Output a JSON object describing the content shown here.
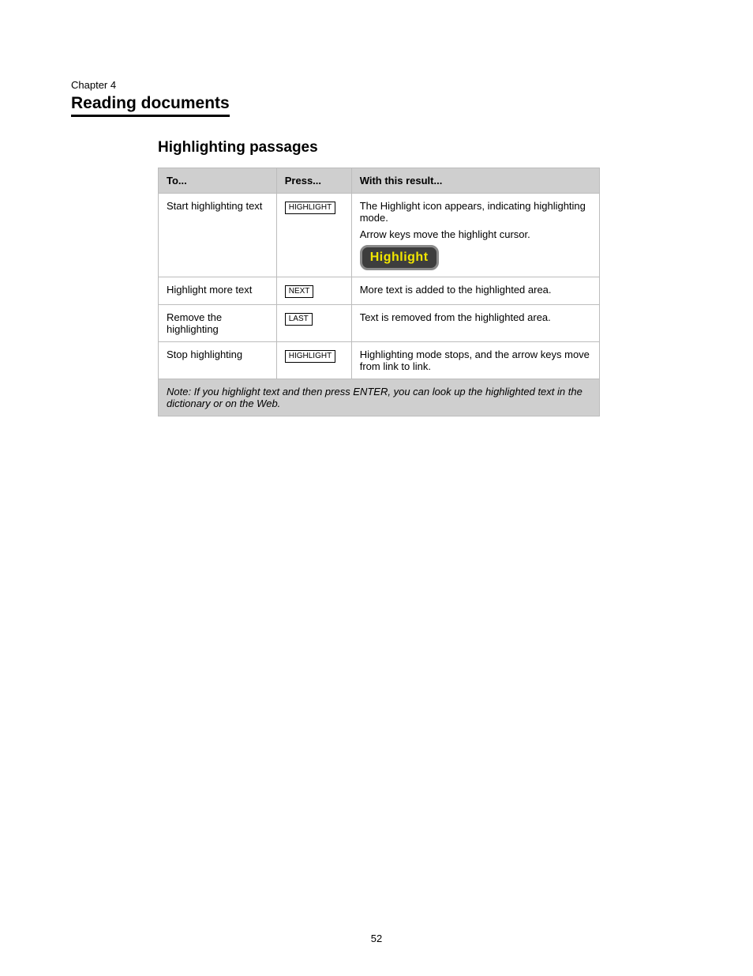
{
  "chapter_line": "Chapter 4",
  "section_title": "Reading documents",
  "section_subhead": "Highlighting passages",
  "table": {
    "headers": {
      "to": "To...",
      "press": "Press...",
      "result": "With this result..."
    },
    "rows": [
      {
        "to": "Start highlighting text",
        "key": "HIGHLIGHT",
        "result_lines": [
          "The Highlight icon appears, indicating highlighting mode.",
          "Arrow keys move the highlight cursor."
        ],
        "show_button": true
      },
      {
        "to": "Highlight more text",
        "key": "NEXT",
        "result_lines": [
          "More text is added to the highlighted area."
        ]
      },
      {
        "to": "Remove the highlighting",
        "key": "LAST",
        "result_lines": [
          "Text is removed from the highlighted area."
        ]
      },
      {
        "to": "Stop highlighting",
        "key": "HIGHLIGHT",
        "result_lines": [
          "Highlighting mode stops, and the arrow keys move from link to link."
        ]
      }
    ],
    "note": "Note: If you highlight text and then press ENTER, you can look up the highlighted text in the dictionary or on the Web."
  },
  "highlight_button_label": "Highlight",
  "page_number": "52"
}
